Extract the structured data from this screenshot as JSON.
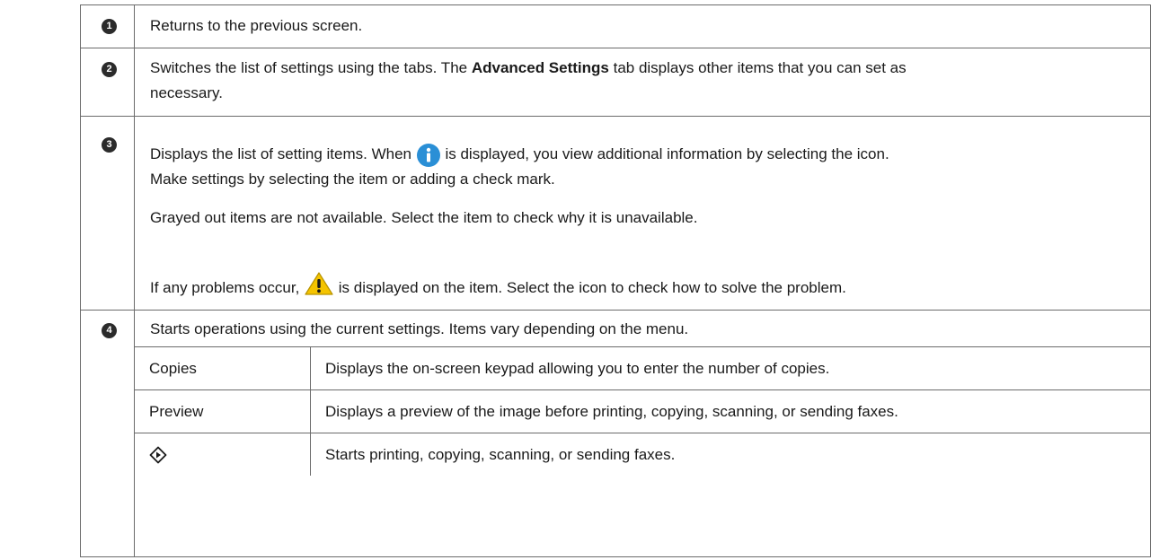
{
  "rows": [
    {
      "number": "1",
      "text": "Returns to the previous screen."
    },
    {
      "number": "2",
      "text_before": "Switches the list of settings using the tabs. The ",
      "bold": "Advanced Settings",
      "text_after": " tab displays other items that you can set as",
      "text_line2": "necessary."
    },
    {
      "number": "3",
      "p1_before": "Displays the list of setting items. When ",
      "p1_after": " is displayed, you view additional information by selecting the icon.",
      "p1_line2": "Make settings by selecting the item or adding a check mark.",
      "p2": "Grayed out items are not available. Select the item to check why it is unavailable.",
      "p3_before": "If any problems occur, ",
      "p3_after": " is displayed on the item. Select the icon to check how to solve the problem.",
      "info_icon": "info-icon",
      "warning_icon": "warning-icon"
    },
    {
      "number": "4",
      "text": "Starts operations using the current settings. Items vary depending on the menu.",
      "subrows": [
        {
          "label": "Copies",
          "description": "Displays the on-screen keypad allowing you to enter the number of copies."
        },
        {
          "label": "Preview",
          "description": "Displays a preview of the image before printing, copying, scanning, or sending faxes."
        },
        {
          "label_icon": "start-diamond-icon",
          "description": "Starts printing, copying, scanning, or sending faxes."
        }
      ]
    }
  ],
  "colors": {
    "info": "#2a8fd6",
    "warning": "#f5c400",
    "border": "#6b6b6b",
    "badge": "#2b2b2b"
  }
}
